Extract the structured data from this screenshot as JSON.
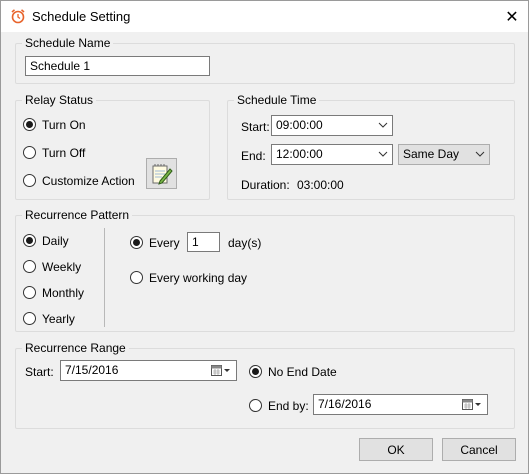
{
  "window": {
    "title": "Schedule Setting",
    "close_glyph": "✕"
  },
  "schedule_name": {
    "group_label": "Schedule Name",
    "value": "Schedule 1"
  },
  "relay_status": {
    "group_label": "Relay Status",
    "options": [
      "Turn On",
      "Turn Off",
      "Customize Action"
    ],
    "selected": "Turn On",
    "action_icon": "notepad-pencil-icon"
  },
  "schedule_time": {
    "group_label": "Schedule Time",
    "start_label": "Start:",
    "start_value": "09:00:00",
    "end_label": "End:",
    "end_value": "12:00:00",
    "day_value": "Same Day",
    "duration_label": "Duration:",
    "duration_value": "03:00:00"
  },
  "recurrence_pattern": {
    "group_label": "Recurrence Pattern",
    "types": [
      "Daily",
      "Weekly",
      "Monthly",
      "Yearly"
    ],
    "selected_type": "Daily",
    "every_label": "Every",
    "every_value": "1",
    "every_unit": "day(s)",
    "working_day_label": "Every working day"
  },
  "recurrence_range": {
    "group_label": "Recurrence Range",
    "start_label": "Start:",
    "start_value": "7/15/2016",
    "no_end_label": "No End Date",
    "end_by_label": "End by:",
    "end_by_value": "7/16/2016",
    "selected": "No End Date"
  },
  "buttons": {
    "ok": "OK",
    "cancel": "Cancel"
  }
}
